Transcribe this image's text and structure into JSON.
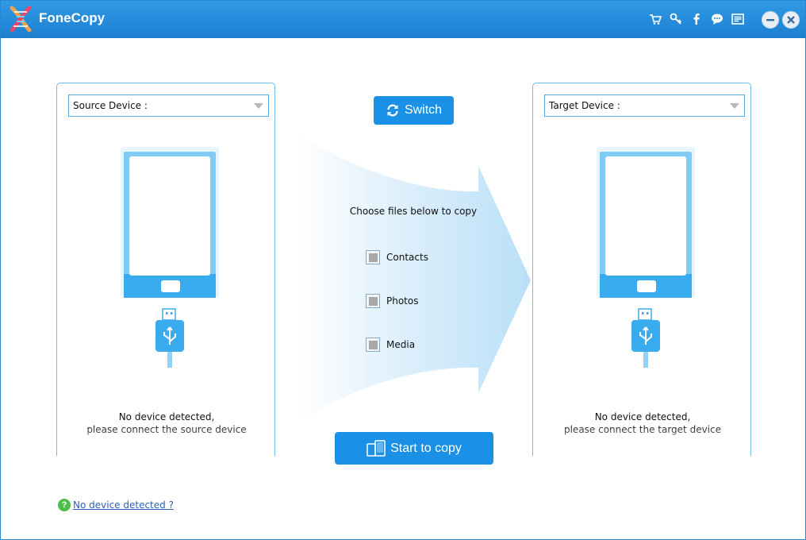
{
  "app": {
    "title": "FoneCopy"
  },
  "toolbar": {
    "icons": [
      "cart-icon",
      "key-icon",
      "facebook-icon",
      "chat-icon",
      "feedback-icon"
    ],
    "minimize": "minimize-icon",
    "close": "close-icon"
  },
  "source": {
    "select_label": "Source Device :",
    "status_line1": "No device detected,",
    "status_line2": "please connect the source device"
  },
  "target": {
    "select_label": "Target Device :",
    "status_line1": "No device detected,",
    "status_line2": "please connect the target device"
  },
  "middle": {
    "switch_label": "Switch",
    "choose_text": "Choose files below to copy",
    "options": [
      {
        "label": "Contacts",
        "checked": false
      },
      {
        "label": "Photos",
        "checked": false
      },
      {
        "label": "Media",
        "checked": false
      }
    ],
    "start_label": "Start to copy"
  },
  "footer": {
    "help_link": "No device detected ?"
  },
  "colors": {
    "accent": "#1a90e6",
    "titlebar": "#2a8ddc",
    "panel_border": "#6cbbe9"
  }
}
